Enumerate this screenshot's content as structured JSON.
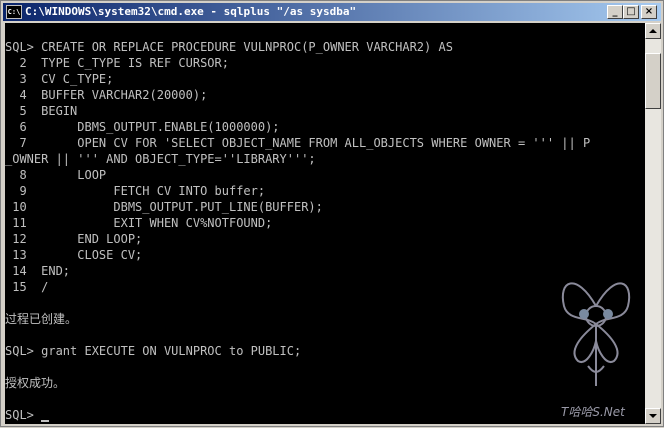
{
  "window": {
    "title": "C:\\WINDOWS\\system32\\cmd.exe - sqlplus \"/as sysdba\"",
    "icon": "C:\\",
    "buttons": {
      "minimize": "_",
      "maximize": "□",
      "close": "×"
    }
  },
  "console": {
    "lines": [
      "",
      "SQL> CREATE OR REPLACE PROCEDURE VULNPROC(P_OWNER VARCHAR2) AS",
      "  2  TYPE C_TYPE IS REF CURSOR;",
      "  3  CV C_TYPE;",
      "  4  BUFFER VARCHAR2(20000);",
      "  5  BEGIN",
      "  6       DBMS_OUTPUT.ENABLE(1000000);",
      "  7       OPEN CV FOR 'SELECT OBJECT_NAME FROM ALL_OBJECTS WHERE OWNER = ''' || P",
      "_OWNER || ''' AND OBJECT_TYPE=''LIBRARY''';",
      "  8       LOOP",
      "  9            FETCH CV INTO buffer;",
      " 10            DBMS_OUTPUT.PUT_LINE(BUFFER);",
      " 11            EXIT WHEN CV%NOTFOUND;",
      " 12       END LOOP;",
      " 13       CLOSE CV;",
      " 14  END;",
      " 15  /",
      "",
      "过程已创建。",
      "",
      "SQL> grant EXECUTE ON VULNPROC to PUBLIC;",
      "",
      "授权成功。",
      "",
      "SQL> "
    ]
  },
  "watermark": {
    "text": "T哈哈S.Net"
  }
}
